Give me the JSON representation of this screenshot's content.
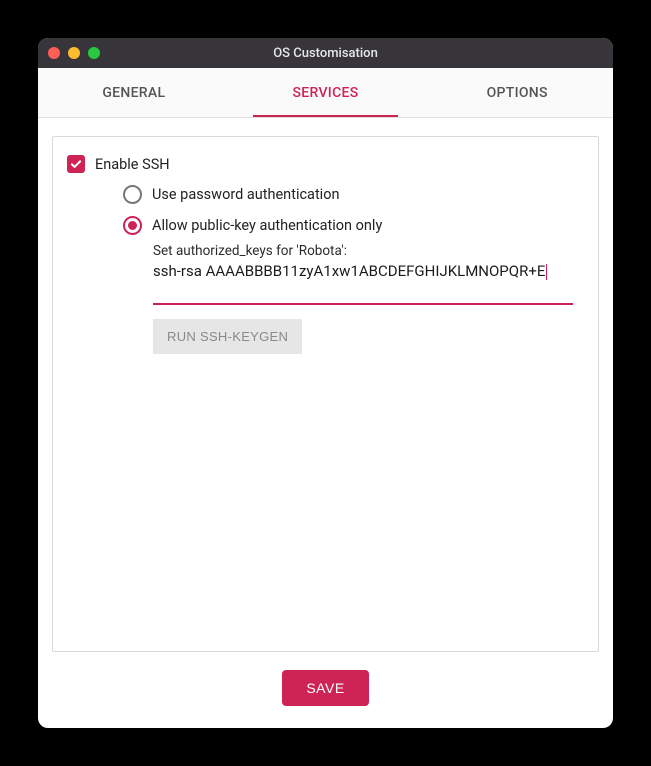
{
  "window": {
    "title": "OS Customisation"
  },
  "tabs": {
    "general": "GENERAL",
    "services": "SERVICES",
    "options": "OPTIONS",
    "active": "services"
  },
  "ssh": {
    "enable_label": "Enable SSH",
    "enabled": true,
    "auth": {
      "password_label": "Use password authentication",
      "pubkey_label": "Allow public-key authentication only",
      "selected": "pubkey"
    },
    "authorized_keys": {
      "label": "Set authorized_keys for 'Robota':",
      "value": "ssh-rsa AAAABBBB11zyA1xw1ABCDEFGHIJKLMNOPQR+E"
    },
    "keygen_button": "RUN SSH-KEYGEN"
  },
  "footer": {
    "save": "SAVE"
  }
}
